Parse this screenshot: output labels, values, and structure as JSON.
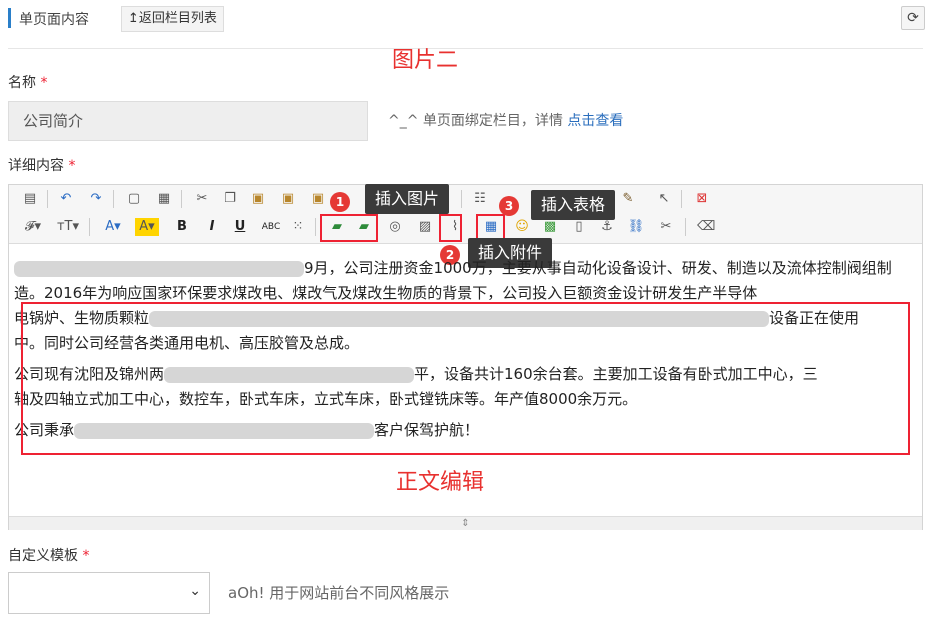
{
  "header": {
    "title": "单页面内容",
    "back_label": "↥返回栏目列表",
    "refresh_icon": "refresh-icon"
  },
  "annotations": {
    "image_two": "图片二",
    "body_edit": "正文编辑"
  },
  "form": {
    "name_label": "名称",
    "required_mark": "*",
    "name_value": "公司简介",
    "name_hint_prefix": "^_^ 单页面绑定栏目，详情 ",
    "name_hint_link": "点击查看",
    "detail_label": "详细内容",
    "template_label": "自定义模板",
    "template_value": "",
    "template_hint": "aOh! 用于网站前台不同风格展示"
  },
  "tooltips": {
    "insert_image": "插入图片",
    "insert_attachment": "插入附件",
    "insert_table": "插入表格",
    "badge1": "1",
    "badge2": "2",
    "badge3": "3"
  },
  "content": {
    "p1_a": "2016年为响应国家环保要求煤改电、煤改气及煤改生物质的背景下，公司投入巨额资金设计研发生产半导体",
    "p1_top": "9月，公司注册资金1000万，主要从事自动化设备设计、研发、制造以及流体控",
    "p1_top2": "制阀组制造。",
    "p1_b": "电锅炉、生物质颗粒",
    "p1_c": "设备正在使用",
    "p1_d": "中。同时公司经营各类通用电机、高压胶管及总成。",
    "p2_a": "公司现有沈阳及锦州两",
    "p2_b": "平，设备共计160余台套。主要加工设备有卧式加工中心，三",
    "p2_c": "轴及四轴立式加工中心，数控车，卧式车床，立式车床，卧式镗铣床等。年产值8000余万元。",
    "p3_a": "公司秉承",
    "p3_b": "客户保驾护航！"
  },
  "icons": {
    "row1": [
      "source-icon",
      "undo-icon",
      "redo-icon",
      "preview-icon",
      "template-icon",
      "cut-icon",
      "copy-icon",
      "paste-icon",
      "paste-text-icon",
      "paste-word-icon"
    ],
    "row2": [
      "font-family-icon",
      "font-size-icon",
      "font-color-icon",
      "highlight-icon",
      "bold-icon",
      "italic-icon",
      "underline-icon",
      "strikethrough-icon",
      "line-height-icon"
    ]
  }
}
